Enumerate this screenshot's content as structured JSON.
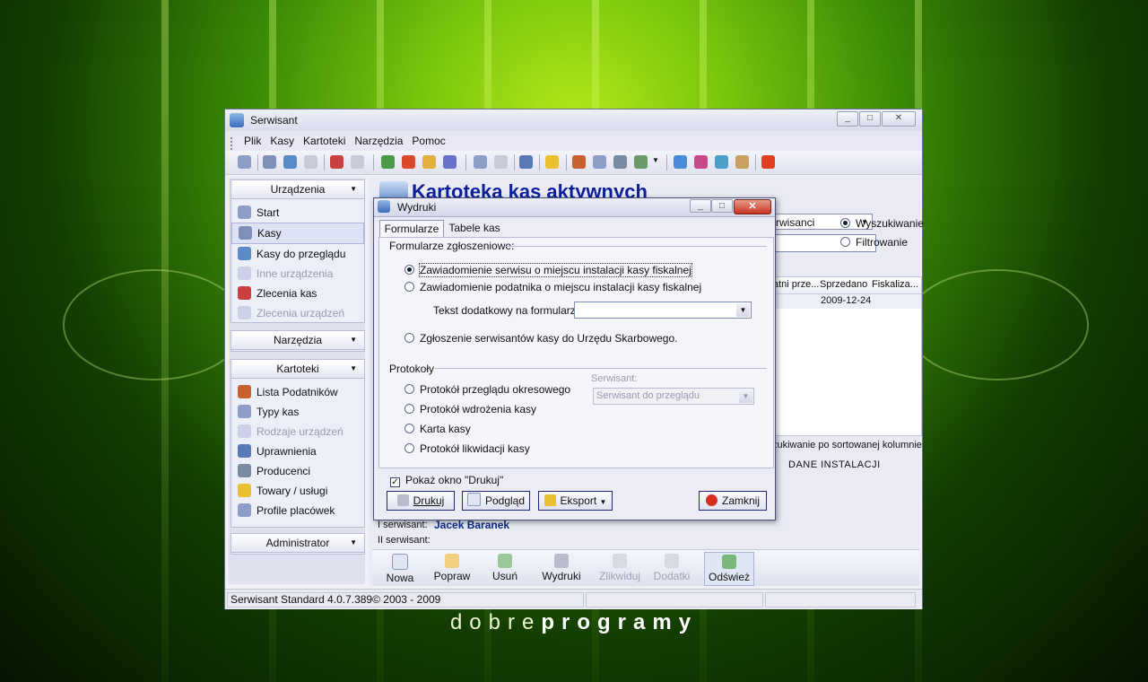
{
  "window": {
    "title": "Serwisant"
  },
  "menu": [
    "Plik",
    "Kasy",
    "Kartoteki",
    "Narzędzia",
    "Pomoc"
  ],
  "sidebar": {
    "groups": [
      {
        "title": "Urządzenia",
        "items": [
          {
            "label": "Start",
            "icon": "home-icon",
            "state": "normal"
          },
          {
            "label": "Kasy",
            "icon": "register-icon",
            "state": "selected"
          },
          {
            "label": "Kasy do przeglądu",
            "icon": "inspect-icon",
            "state": "normal"
          },
          {
            "label": "Inne urządzenia",
            "icon": "device-icon",
            "state": "disabled"
          },
          {
            "label": "Zlecenia kas",
            "icon": "order-icon",
            "state": "normal"
          },
          {
            "label": "Zlecenia urządzeń",
            "icon": "device-order-icon",
            "state": "disabled"
          }
        ]
      },
      {
        "title": "Narzędzia",
        "items": []
      },
      {
        "title": "Kartoteki",
        "items": [
          {
            "label": "Lista Podatników",
            "icon": "people-icon",
            "state": "normal"
          },
          {
            "label": "Typy kas",
            "icon": "register-type-icon",
            "state": "normal"
          },
          {
            "label": "Rodzaje urządzeń",
            "icon": "tree-icon",
            "state": "disabled"
          },
          {
            "label": "Uprawnienia",
            "icon": "permissions-icon",
            "state": "normal"
          },
          {
            "label": "Producenci",
            "icon": "tools-icon",
            "state": "normal"
          },
          {
            "label": "Towary / usługi",
            "icon": "goods-icon",
            "state": "normal"
          },
          {
            "label": "Profile placówek",
            "icon": "profile-icon",
            "state": "normal"
          }
        ]
      },
      {
        "title": "Administrator",
        "items": []
      }
    ]
  },
  "content": {
    "title": "Kartoteka kas aktywnych",
    "search_combo": "rwisanci",
    "radio_search": "Wyszukiwanie",
    "radio_filter": "Filtrowanie",
    "columns": [
      "atni prze...",
      "Sprzedano",
      "Fiskaliza..."
    ],
    "row": [
      "",
      "2009-12-24",
      ""
    ],
    "sort_hint": "zukiwanie po sortowanej kolumnie",
    "panel_title": "DANE INSTALACJI",
    "serwisant1_label": "I serwisant:",
    "serwisant1_value": "Jacek Baranek",
    "serwisant2_label": "II serwisant:"
  },
  "bottom_buttons": [
    {
      "label": "Nowa",
      "state": "normal"
    },
    {
      "label": "Popraw",
      "state": "normal"
    },
    {
      "label": "Usuń",
      "state": "normal"
    },
    {
      "label": "Wydruki",
      "state": "normal"
    },
    {
      "label": "Zlikwiduj",
      "state": "disabled"
    },
    {
      "label": "Dodatki",
      "state": "disabled"
    },
    {
      "label": "Odśwież",
      "state": "normal"
    }
  ],
  "status": {
    "text": "Serwisant Standard 4.0.7.389© 2003 - 2009"
  },
  "dialog": {
    "title": "Wydruki",
    "tabs": [
      "Formularze",
      "Tabele kas"
    ],
    "group1": "Formularze zgłoszeniowe:",
    "options1": [
      "Zawiadomienie serwisu o miejscu instalacji kasy fiskalnej",
      "Zawiadomienie podatnika o miejscu instalacji kasy fiskalnej"
    ],
    "extra_label": "Tekst dodatkowy na formularzu:",
    "option3": "Zgłoszenie serwisantów kasy do Urzędu Skarbowego.",
    "group2": "Protokoły",
    "protocols": [
      "Protokół przeglądu okresowego",
      "Protokół wdrożenia kasy",
      "Karta kasy",
      "Protokół likwidacji kasy"
    ],
    "serwisant_label": "Serwisant:",
    "serwisant_combo": "Serwisant do przeglądu",
    "show_window": "Pokaż okno \"Drukuj\"",
    "buttons": {
      "print": "Drukuj",
      "preview": "Podgląd",
      "export": "Eksport",
      "close": "Zamknij"
    }
  },
  "brand": {
    "light": "dobre",
    "bold": "programy"
  },
  "colors": {
    "title_blue": "#0b1f9a",
    "serwisant_blue": "#0c2a8a",
    "close_red": "#c63420"
  }
}
